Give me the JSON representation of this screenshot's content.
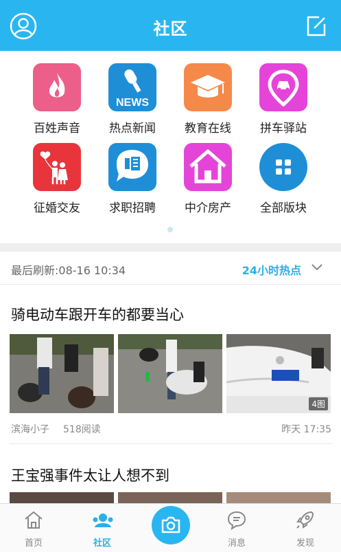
{
  "header": {
    "title": "社区",
    "user_icon": "user-circle-icon",
    "compose_icon": "compose-icon",
    "bg_color": "#29b6f0"
  },
  "grid": [
    {
      "label": "百姓声音",
      "icon": "flame-icon",
      "color": "#ec5f8a"
    },
    {
      "label": "热点新闻",
      "icon": "news-microphone-icon",
      "color": "#1e8fd6"
    },
    {
      "label": "教育在线",
      "icon": "graduation-cap-icon",
      "color": "#f5894a"
    },
    {
      "label": "拼车驿站",
      "icon": "car-pin-icon",
      "color": "#e445d8"
    },
    {
      "label": "征婚交友",
      "icon": "couple-balloon-icon",
      "color": "#e8353b"
    },
    {
      "label": "求职招聘",
      "icon": "hire-icon",
      "color": "#1e8fd6"
    },
    {
      "label": "中介房产",
      "icon": "house-icon",
      "color": "#e445d8"
    },
    {
      "label": "全部版块",
      "icon": "grid-apps-icon",
      "color": "#1e8fd6"
    }
  ],
  "refresh": {
    "last_refresh": "最后刷新:08-16 10:34",
    "hot_filter": "24小时热点",
    "accent_color": "#29b0e8"
  },
  "posts": [
    {
      "title": "骑电动车跟开车的都要当心",
      "author": "滨海小子",
      "reads": "518阅读",
      "time": "昨天 17:35",
      "image_count": "4图"
    },
    {
      "title": "王宝强事件太让人想不到"
    }
  ],
  "tabbar": {
    "home": "首页",
    "community": "社区",
    "messages": "消息",
    "discover": "发现",
    "camera_icon": "camera-icon"
  }
}
